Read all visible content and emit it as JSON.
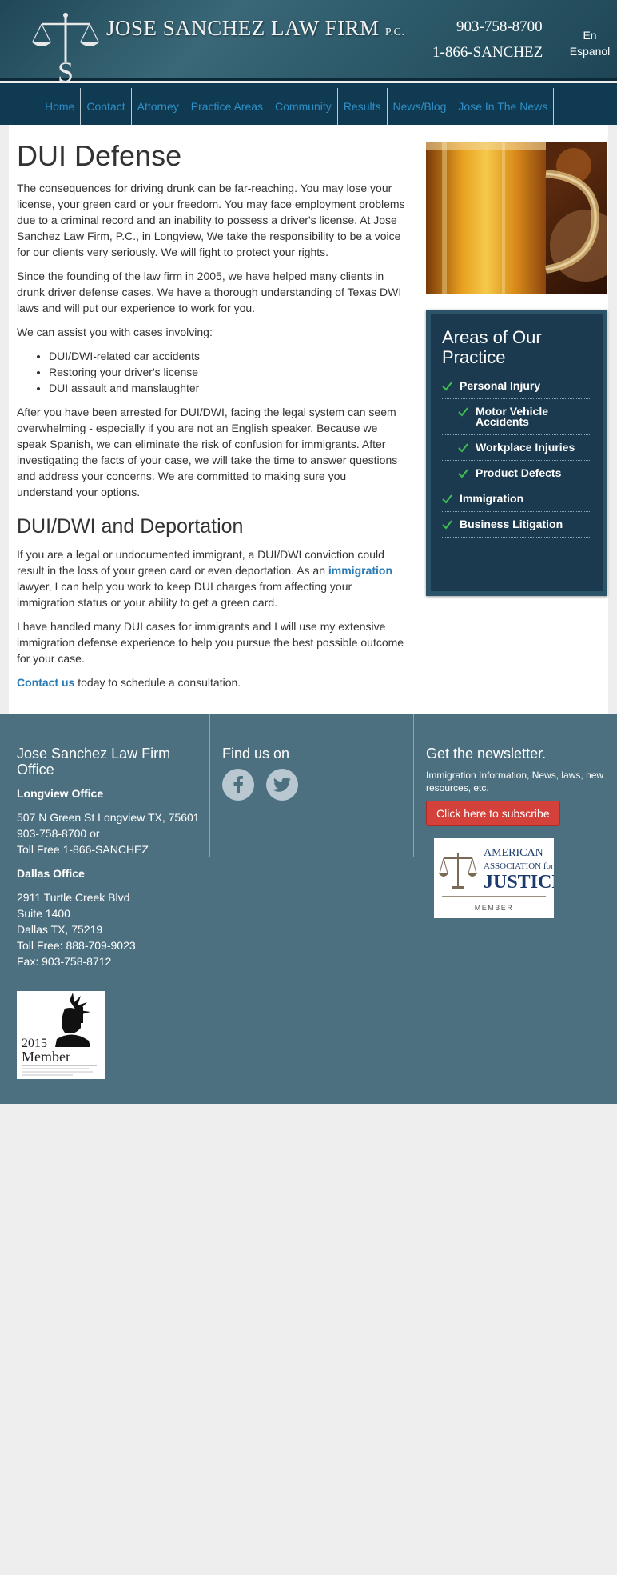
{
  "header": {
    "firm_name": "JOSE SANCHEZ LAW FIRM",
    "firm_suffix": "P.C.",
    "logo_letter": "S",
    "phone_primary": "903-758-8700",
    "phone_vanity": "1-866-SANCHEZ",
    "lang_en": "En",
    "lang_es": "Espanol"
  },
  "nav": {
    "items": [
      "Home",
      "Contact",
      "Attorney",
      "Practice Areas",
      "Community",
      "Results",
      "News/Blog",
      "Jose In The News"
    ]
  },
  "main": {
    "title": "DUI Defense",
    "p1": "The consequences for driving drunk can be far-reaching. You may lose your license, your green card or your freedom. You may face employment problems due to a criminal record and an inability to possess a driver's license. At Jose Sanchez Law Firm, P.C., in Longview, We take the responsibility to be a voice for our clients very seriously. We will fight to protect your rights.",
    "p2": "Since the founding of the law firm in 2005, we have helped many clients in drunk driver defense cases. We have a thorough understanding of Texas DWI laws and will put our experience to work for you.",
    "p3": "We can assist you with cases involving:",
    "list": [
      "DUI/DWI-related car accidents",
      "Restoring your driver's license",
      "DUI assault and manslaughter"
    ],
    "p4": "After you have been arrested for DUI/DWI, facing the legal system can seem overwhelming - especially if you are not an English speaker. Because we speak Spanish, we can eliminate the risk of confusion for immigrants. After investigating the facts of your case, we will take the time to answer questions and address your concerns. We are committed to making sure you understand your options.",
    "h2": "DUI/DWI and Deportation",
    "p5_before": "If you are a legal or undocumented immigrant, a DUI/DWI conviction could result in the loss of your green card or even deportation. As an ",
    "p5_link": "immigration",
    "p5_after": " lawyer, I can help you work to keep DUI charges from affecting your immigration status or your ability to get a green card.",
    "p6": "I have handled many DUI cases for immigrants and I will use my extensive immigration defense experience to help you pursue the best possible outcome for your case.",
    "p7_link": "Contact us",
    "p7_after": " today to schedule a consultation."
  },
  "areas": {
    "title": "Areas of Our Practice",
    "items": [
      {
        "label": "Personal Injury",
        "sub": false
      },
      {
        "label": "Motor Vehicle Accidents",
        "sub": true
      },
      {
        "label": "Workplace Injuries",
        "sub": true
      },
      {
        "label": "Product Defects",
        "sub": true
      },
      {
        "label": "Immigration",
        "sub": false
      },
      {
        "label": "Business Litigation",
        "sub": false
      }
    ]
  },
  "footer": {
    "office_title": "Jose Sanchez Law Firm Office",
    "longview_title": "Longview Office",
    "longview_address": "507 N Green St Longview TX, 75601",
    "longview_phone": "903-758-8700 or",
    "longview_tollfree": "Toll Free 1-866-SANCHEZ",
    "dallas_title": "Dallas Office",
    "dallas_street": "2911 Turtle Creek Blvd",
    "dallas_suite": "Suite 1400",
    "dallas_city": "Dallas TX, 75219",
    "dallas_tollfree": "Toll Free: 888-709-9023",
    "dallas_fax": "Fax: 903-758-8712",
    "findus_title": "Find us on",
    "newsletter_title": "Get the newsletter.",
    "newsletter_text": "Immigration Information, News, laws, new resources, etc.",
    "subscribe_label": "Click here to subscribe",
    "aaj_line1": "AMERICAN",
    "aaj_line2": "ASSOCIATION for",
    "aaj_line3": "JUSTICE",
    "aaj_member": "MEMBER",
    "badge_year": "2015",
    "badge_member": "Member"
  },
  "colors": {
    "nav_link": "#2f8fc7",
    "link": "#2a7ab5",
    "check": "#3fbf4f",
    "footer_bg": "#4d7080",
    "subscribe_bg": "#d4403a"
  }
}
